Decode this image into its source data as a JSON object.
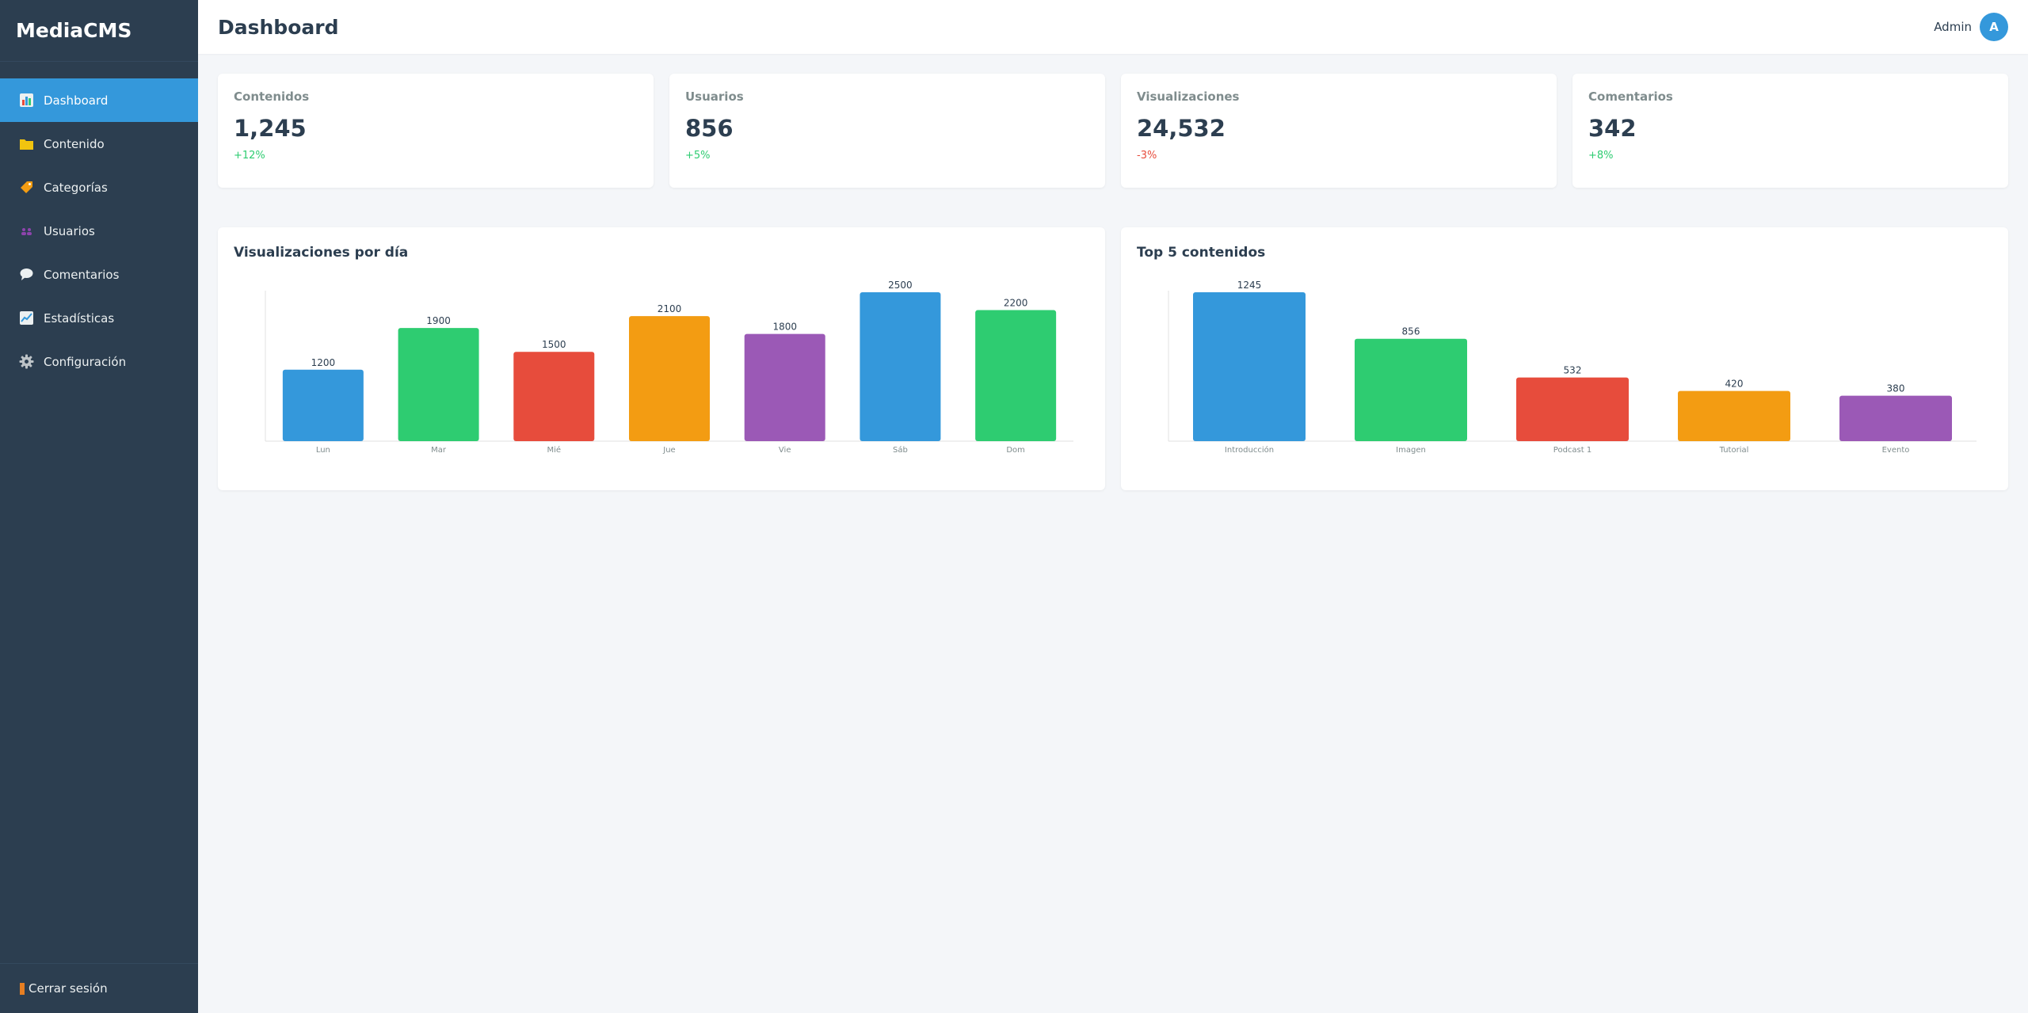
{
  "sidebar": {
    "brand": "MediaCMS",
    "items": [
      {
        "label": "Dashboard",
        "icon": "bar-chart-icon",
        "active": true
      },
      {
        "label": "Contenido",
        "icon": "folder-icon",
        "active": false
      },
      {
        "label": "Categorías",
        "icon": "tag-icon",
        "active": false
      },
      {
        "label": "Usuarios",
        "icon": "users-icon",
        "active": false
      },
      {
        "label": "Comentarios",
        "icon": "speech-bubble-icon",
        "active": false
      },
      {
        "label": "Estadísticas",
        "icon": "line-chart-icon",
        "active": false
      },
      {
        "label": "Configuración",
        "icon": "gear-icon",
        "active": false
      }
    ],
    "logout_label": "Cerrar sesión"
  },
  "header": {
    "title": "Dashboard",
    "user_name": "Admin",
    "avatar_initial": "A"
  },
  "stats": [
    {
      "label": "Contenidos",
      "value": "1,245",
      "delta": "+12%",
      "trend": "up"
    },
    {
      "label": "Usuarios",
      "value": "856",
      "delta": "+5%",
      "trend": "up"
    },
    {
      "label": "Visualizaciones",
      "value": "24,532",
      "delta": "-3%",
      "trend": "down"
    },
    {
      "label": "Comentarios",
      "value": "342",
      "delta": "+8%",
      "trend": "up"
    }
  ],
  "colors": {
    "accent": "#3498db",
    "sidebar_bg": "#2c3e50",
    "positive": "#2ecc71",
    "negative": "#e74c3c"
  },
  "chart_data": [
    {
      "type": "bar",
      "title": "Visualizaciones por día",
      "categories": [
        "Lun",
        "Mar",
        "Mié",
        "Jue",
        "Vie",
        "Sáb",
        "Dom"
      ],
      "values": [
        1200,
        1900,
        1500,
        2100,
        1800,
        2500,
        2200
      ],
      "colors": [
        "#3498db",
        "#2ecc71",
        "#e74c3c",
        "#f39c12",
        "#9b59b6",
        "#3498db",
        "#2ecc71"
      ],
      "ylim": [
        0,
        2500
      ],
      "grid": false,
      "legend": "none"
    },
    {
      "type": "bar",
      "title": "Top 5 contenidos",
      "categories": [
        "Introducción",
        "Imagen",
        "Podcast 1",
        "Tutorial",
        "Evento"
      ],
      "values": [
        1245,
        856,
        532,
        420,
        380
      ],
      "colors": [
        "#3498db",
        "#2ecc71",
        "#e74c3c",
        "#f39c12",
        "#9b59b6"
      ],
      "ylim": [
        0,
        1245
      ],
      "grid": false,
      "legend": "none"
    }
  ]
}
